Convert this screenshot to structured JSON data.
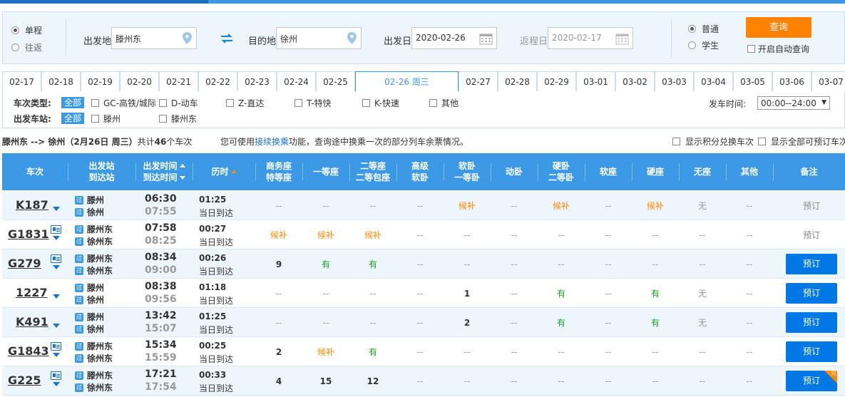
{
  "search": {
    "trip_types": [
      {
        "label": "单程",
        "selected": true
      },
      {
        "label": "往返",
        "selected": false
      }
    ],
    "from_label": "出发地",
    "from_value": "滕州东",
    "to_label": "目的地",
    "to_value": "徐州",
    "date_label": "出发日",
    "date_value": "2020-02-26",
    "return_label": "返程日",
    "return_value": "2020-02-17",
    "passenger_types": [
      {
        "label": "普通",
        "selected": true
      },
      {
        "label": "学生",
        "selected": false
      }
    ],
    "query_label": "查询",
    "auto_query_label": "开启自动查询"
  },
  "date_tabs": [
    "02-17",
    "02-18",
    "02-19",
    "02-20",
    "02-21",
    "02-22",
    "02-23",
    "02-24",
    "02-25",
    "02-26  周三",
    "02-27",
    "02-28",
    "02-29",
    "03-01",
    "03-02",
    "03-03",
    "03-04",
    "03-05",
    "03-06",
    "03-07"
  ],
  "active_date_index": 9,
  "filters": {
    "type_label": "车次类型:",
    "station_label": "出发车站:",
    "all_label": "全部",
    "types": [
      "GC-高铁/城际",
      "D-动车",
      "Z-直达",
      "T-特快",
      "K-快速",
      "其他"
    ],
    "stations": [
      "滕州",
      "滕州东"
    ],
    "time_label": "发车时间:",
    "time_value": "00:00--24:00"
  },
  "summary": {
    "route": "滕州东 --> 徐州（2月26日  周三）",
    "count_prefix": "共计",
    "count": "46",
    "count_suffix": "个车次",
    "hint_prefix": "您可使用",
    "hint_link": "接续换乘",
    "hint_suffix": "功能，查询途中换乘一次的部分列车余票情况。",
    "option1": "显示积分兑换车次",
    "option2": "显示全部可预订车次"
  },
  "table": {
    "headers": {
      "train": "车次",
      "stations_1": "出发站",
      "stations_2": "到达站",
      "times_1": "出发时间",
      "times_2": "到达时间",
      "duration": "历时",
      "business_1": "商务座",
      "business_2": "特等座",
      "first": "一等座",
      "second_1": "二等座",
      "second_2": "二等包座",
      "premium_1": "高级",
      "premium_2": "软卧",
      "soft_sleeper_1": "软卧",
      "soft_sleeper_2": "一等卧",
      "moving_sleeper": "动卧",
      "hard_sleeper_1": "硬卧",
      "hard_sleeper_2": "二等卧",
      "soft_seat": "软座",
      "hard_seat": "硬座",
      "no_seat": "无座",
      "other": "其他",
      "remark": "备注"
    },
    "rows": [
      {
        "code": "K187",
        "card": false,
        "from": "滕州",
        "to": "徐州",
        "dep": "06:30",
        "arr": "07:55",
        "dur": "01:25",
        "day": "当日到达",
        "seats": [
          "--",
          "--",
          "--",
          "--",
          "候补",
          "--",
          "候补",
          "--",
          "候补",
          "无",
          "--"
        ],
        "remark": "预订",
        "bookable": false,
        "corner": false
      },
      {
        "code": "G1831",
        "card": true,
        "from": "滕州东",
        "to": "徐州东",
        "dep": "07:58",
        "arr": "08:25",
        "dur": "00:27",
        "day": "当日到达",
        "seats": [
          "候补",
          "候补",
          "候补",
          "--",
          "--",
          "--",
          "--",
          "--",
          "--",
          "--",
          "--"
        ],
        "remark": "预订",
        "bookable": false,
        "corner": false
      },
      {
        "code": "G279",
        "card": true,
        "from": "滕州东",
        "to": "徐州东",
        "dep": "08:34",
        "arr": "09:00",
        "dur": "00:26",
        "day": "当日到达",
        "seats": [
          "9",
          "有",
          "有",
          "--",
          "--",
          "--",
          "--",
          "--",
          "--",
          "--",
          "--"
        ],
        "remark": "预订",
        "bookable": true,
        "corner": false
      },
      {
        "code": "1227",
        "card": false,
        "from": "滕州",
        "to": "徐州",
        "dep": "08:38",
        "arr": "09:56",
        "dur": "01:18",
        "day": "当日到达",
        "seats": [
          "--",
          "--",
          "--",
          "--",
          "1",
          "--",
          "有",
          "--",
          "有",
          "无",
          "--"
        ],
        "remark": "预订",
        "bookable": true,
        "corner": false
      },
      {
        "code": "K491",
        "card": false,
        "from": "滕州",
        "to": "徐州",
        "dep": "13:42",
        "arr": "15:07",
        "dur": "01:25",
        "day": "当日到达",
        "seats": [
          "--",
          "--",
          "--",
          "--",
          "2",
          "--",
          "有",
          "--",
          "有",
          "无",
          "--"
        ],
        "remark": "预订",
        "bookable": true,
        "corner": false
      },
      {
        "code": "G1843",
        "card": true,
        "from": "滕州东",
        "to": "徐州东",
        "dep": "15:34",
        "arr": "15:59",
        "dur": "00:25",
        "day": "当日到达",
        "seats": [
          "2",
          "候补",
          "有",
          "--",
          "--",
          "--",
          "--",
          "--",
          "--",
          "--",
          "--"
        ],
        "remark": "预订",
        "bookable": true,
        "corner": false
      },
      {
        "code": "G225",
        "card": true,
        "from": "滕州东",
        "to": "徐州东",
        "dep": "17:21",
        "arr": "17:54",
        "dur": "00:33",
        "day": "当日到达",
        "seats": [
          "4",
          "15",
          "12",
          "--",
          "--",
          "--",
          "--",
          "--",
          "--",
          "--",
          "--"
        ],
        "remark": "预订",
        "bookable": true,
        "corner": true,
        "corner_label": "兑"
      }
    ],
    "station_icon_label": "过"
  },
  "colors": {
    "accent": "#3b99e5",
    "query": "#ff8200",
    "book": "#0078e5",
    "wait": "#ff8a00",
    "available": "#1a9f27"
  }
}
